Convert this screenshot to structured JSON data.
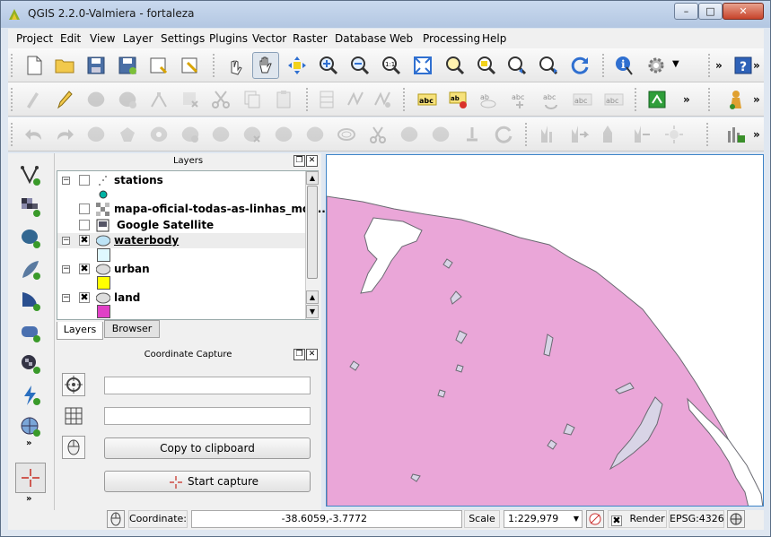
{
  "window": {
    "title": "QGIS 2.2.0-Valmiera - fortaleza",
    "min_glyph": "–",
    "max_glyph": "□",
    "close_glyph": "✕"
  },
  "menu": [
    "Project",
    "Edit",
    "View",
    "Layer",
    "Settings",
    "Plugins",
    "Vector",
    "Raster",
    "Database",
    "Web",
    "Processing",
    "Help"
  ],
  "toolbar": {
    "more": "»"
  },
  "layers_panel": {
    "title": "Layers",
    "float_glyph": "❐",
    "close_glyph": "✕",
    "expand_glyph": "−",
    "check_glyph": "✖",
    "layers": [
      {
        "name": "stations",
        "checked": false,
        "swatch": "#00b3a4"
      },
      {
        "name": "mapa-oficial-todas-as-linhas_mod...",
        "checked": false,
        "swatch": ""
      },
      {
        "name": "Google Satellite",
        "checked": false,
        "swatch": ""
      },
      {
        "name": "waterbody",
        "checked": true,
        "swatch": "#dff8ff"
      },
      {
        "name": "urban",
        "checked": true,
        "swatch": "#ffff00"
      },
      {
        "name": "land",
        "checked": true,
        "swatch": "#e040c6"
      }
    ],
    "tabs": [
      "Layers",
      "Browser"
    ]
  },
  "capture_panel": {
    "title": "Coordinate Capture",
    "field_1": "",
    "field_2": "",
    "copy_label": "Copy to clipboard",
    "start_label": "Start capture"
  },
  "statusbar": {
    "coordinate_label": "Coordinate:",
    "coordinate_value": "-38.6059,-3.7772",
    "scale_label": "Scale",
    "scale_value": "1:229,979",
    "render_label": "Render",
    "render_checked": true,
    "crs": "EPSG:4326"
  },
  "map": {
    "land_color": "#eaa6d8",
    "water_color": "#ffffff",
    "lagoon_color": "#d8d4e6",
    "outline_color": "#6a6a72"
  }
}
